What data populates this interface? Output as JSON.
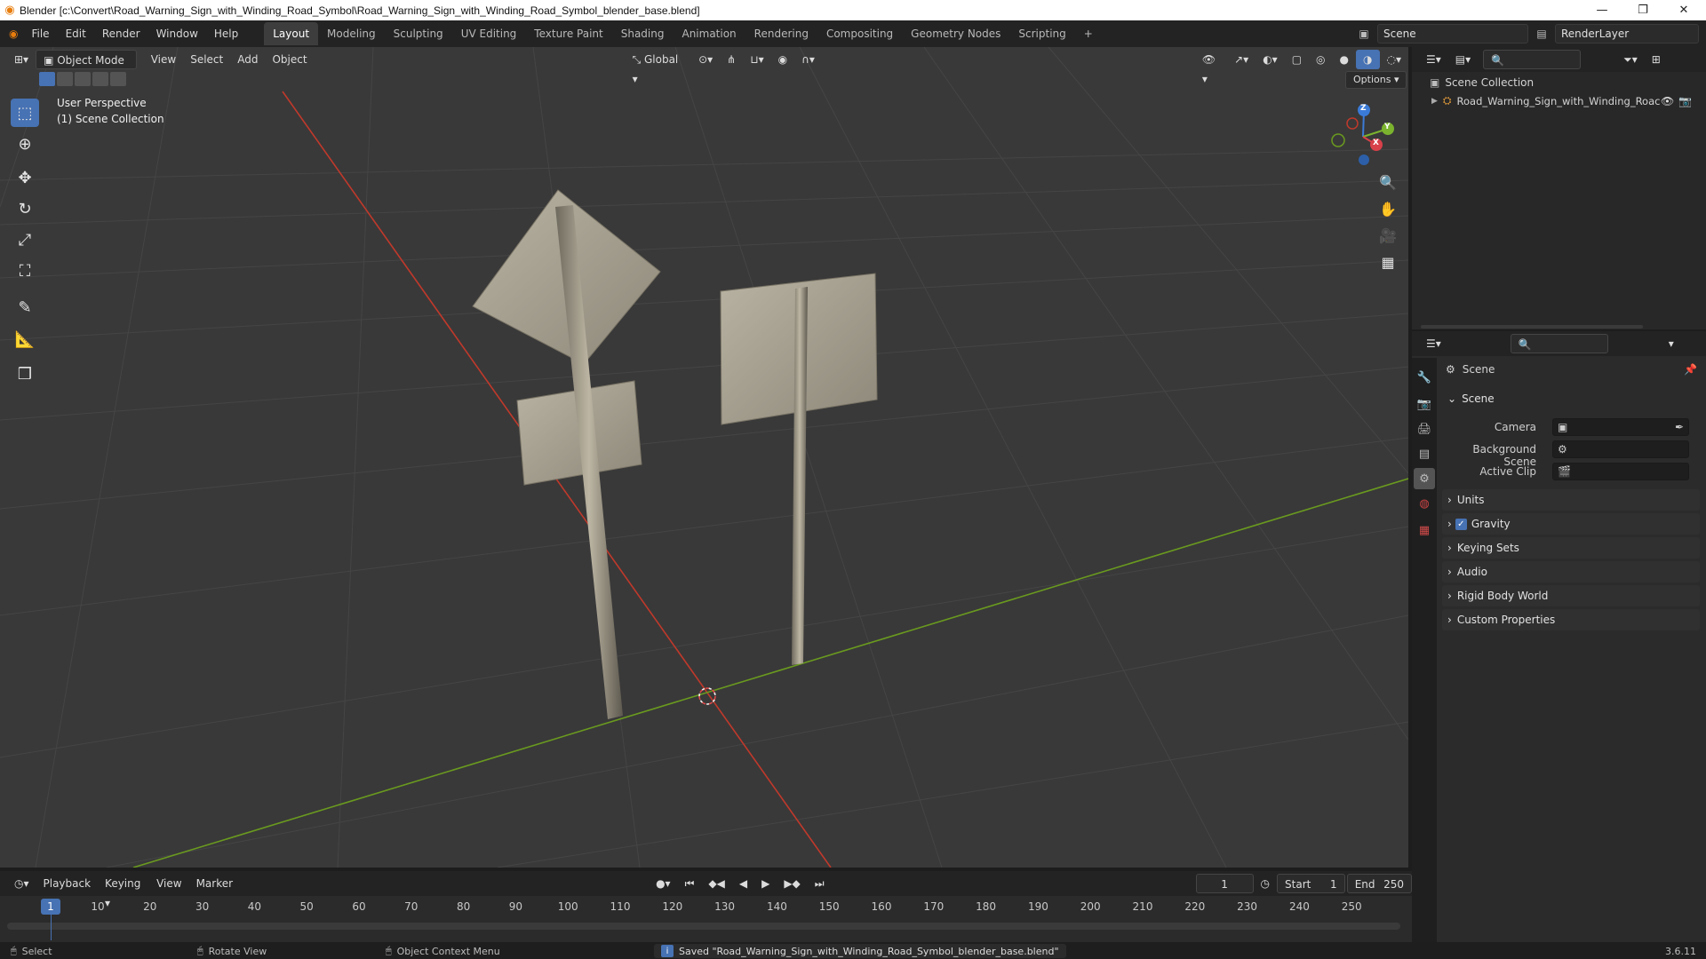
{
  "window": {
    "title": "Blender [c:\\Convert\\Road_Warning_Sign_with_Winding_Road_Symbol\\Road_Warning_Sign_with_Winding_Road_Symbol_blender_base.blend]",
    "controls": [
      "—",
      "❐",
      "✕"
    ]
  },
  "menu": [
    "File",
    "Edit",
    "Render",
    "Window",
    "Help"
  ],
  "workspaces": [
    "Layout",
    "Modeling",
    "Sculpting",
    "UV Editing",
    "Texture Paint",
    "Shading",
    "Animation",
    "Rendering",
    "Compositing",
    "Geometry Nodes",
    "Scripting",
    "+"
  ],
  "active_workspace": "Layout",
  "scene_selector": "Scene",
  "view_layer": "RenderLayer",
  "viewport": {
    "mode": "Object Mode",
    "menus": [
      "View",
      "Select",
      "Add",
      "Object"
    ],
    "orientation": "Global",
    "options_label": "Options",
    "overlay_line1": "User Perspective",
    "overlay_line2": "(1) Scene Collection",
    "gizmo_axes": {
      "x": "X",
      "y": "Y",
      "z": "Z"
    },
    "colors": {
      "background": "#393939",
      "x_axis": "#c0392b",
      "y_axis": "#6a9a1f",
      "accent": "#4772b3"
    }
  },
  "outliner": {
    "root": "Scene Collection",
    "items": [
      {
        "label": "Road_Warning_Sign_with_Winding_Roac"
      }
    ]
  },
  "properties": {
    "header": "Scene",
    "scene_panel": {
      "title": "Scene",
      "camera_label": "Camera",
      "background_scene_label": "Background Scene",
      "active_clip_label": "Active Clip"
    },
    "collapsed_panels": [
      "Units",
      "Gravity",
      "Keying Sets",
      "Audio",
      "Rigid Body World",
      "Custom Properties"
    ],
    "gravity_checked": true
  },
  "timeline": {
    "menus": [
      "Playback",
      "Keying",
      "View",
      "Marker"
    ],
    "current_frame": "1",
    "start_label": "Start",
    "start_value": "1",
    "end_label": "End",
    "end_value": "250",
    "ruler": [
      "10",
      "20",
      "30",
      "40",
      "50",
      "60",
      "70",
      "80",
      "90",
      "100",
      "110",
      "120",
      "130",
      "140",
      "150",
      "160",
      "170",
      "180",
      "190",
      "200",
      "210",
      "220",
      "230",
      "240",
      "250"
    ],
    "playhead_label": "1"
  },
  "statusbar": {
    "select": "Select",
    "rotate": "Rotate View",
    "context": "Object Context Menu",
    "message": "Saved \"Road_Warning_Sign_with_Winding_Road_Symbol_blender_base.blend\"",
    "version": "3.6.11"
  }
}
